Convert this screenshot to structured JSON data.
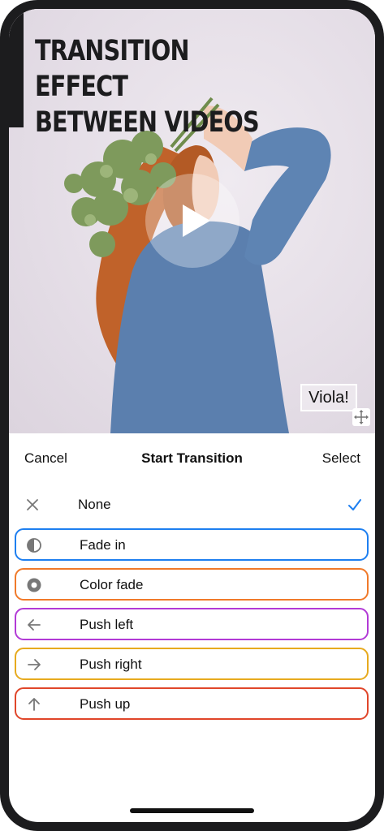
{
  "video": {
    "title_line1": "TRANSITION EFFECT",
    "title_line2": "BETWEEN VIDEOS",
    "caption": "Viola!",
    "play_icon": "play-icon",
    "move_icon": "move-icon"
  },
  "sheet": {
    "cancel_label": "Cancel",
    "title": "Start Transition",
    "select_label": "Select",
    "options": [
      {
        "label": "None",
        "icon": "close-icon",
        "selected": true,
        "border": ""
      },
      {
        "label": "Fade in",
        "icon": "half-circle-icon",
        "selected": false,
        "border": "#1e7ff0"
      },
      {
        "label": "Color fade",
        "icon": "radio-dot-icon",
        "selected": false,
        "border": "#f07a2a"
      },
      {
        "label": "Push left",
        "icon": "arrow-left-icon",
        "selected": false,
        "border": "#b23ad6"
      },
      {
        "label": "Push right",
        "icon": "arrow-right-icon",
        "selected": false,
        "border": "#e7aa1e"
      },
      {
        "label": "Push up",
        "icon": "arrow-up-icon",
        "selected": false,
        "border": "#e0462a"
      }
    ]
  },
  "colors": {
    "accent": "#1e7ff0"
  }
}
